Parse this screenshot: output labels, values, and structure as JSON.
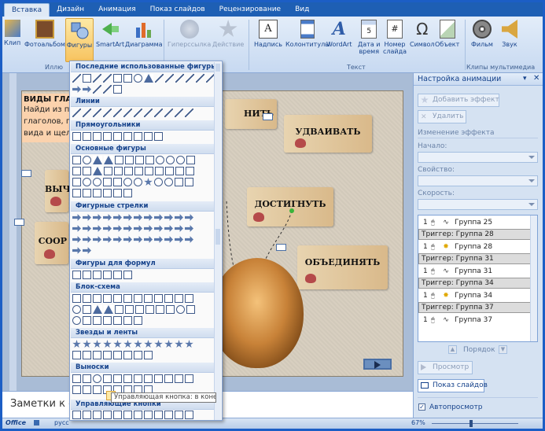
{
  "tabs": [
    "Вставка",
    "Дизайн",
    "Анимация",
    "Показ слайдов",
    "Рецензирование",
    "Вид"
  ],
  "ribbon": {
    "clip": "Клип",
    "photoalbum": "Фотоальбом",
    "shapes": "Фигуры",
    "smartart": "SmartArt",
    "chart": "Диаграмма",
    "hyperlink": "Гиперссылка",
    "action": "Действие",
    "textbox": "Надпись",
    "headers": "Колонтитулы",
    "wordart": "WordArt",
    "datetime_1": "Дата и",
    "datetime_2": "время",
    "slidenum_1": "Номер",
    "slidenum_2": "слайда",
    "symbol": "Символ",
    "object": "Объект",
    "movie": "Фильм",
    "sound": "Звук",
    "group_illustrations": "Иллю",
    "group_text": "Текст",
    "group_media": "Клипы мультимедиа"
  },
  "gallery": {
    "recent": "Последние использованные фигуры",
    "lines": "Линии",
    "rectangles": "Прямоугольники",
    "basic": "Основные фигуры",
    "arrows": "Фигурные стрелки",
    "equation": "Фигуры для формул",
    "flowchart": "Блок-схема",
    "stars": "Звезды и ленты",
    "callouts": "Выноски",
    "action_buttons": "Управляющие кнопки"
  },
  "tooltip": "Управляющая кнопка: в конец",
  "slide": {
    "heading": "ВИДЫ ГЛАГ",
    "text_1": "Найди из п",
    "text_2": "глаголов, г",
    "text_3": "вида и щел",
    "s_udvaivat": "УДВАИВАТЬ",
    "s_dostignut": "ДОСТИГНУТЬ",
    "s_obedinyat": "ОБЪЕДИНЯТЬ",
    "s_nit": "НИТЬ",
    "s_vych": "ВЫЧ",
    "s_soor": "СООР"
  },
  "notes": "Заметки к сл",
  "status": {
    "office": "Office",
    "lang": "русс",
    "zoom": "67%"
  },
  "pane": {
    "title": "Настройка анимации",
    "add_effect": "Добавить эффект",
    "remove": "Удалить",
    "change_effect": "Изменение эффекта",
    "start": "Начало:",
    "property": "Свойство:",
    "speed": "Скорость:",
    "items": [
      {
        "type": "row",
        "num": "1",
        "effect": "path",
        "label": "Группа 25"
      },
      {
        "type": "trigger",
        "label": "Триггер: Группа 28"
      },
      {
        "type": "row",
        "num": "1",
        "effect": "star",
        "label": "Группа 28"
      },
      {
        "type": "trigger",
        "label": "Триггер: Группа 31"
      },
      {
        "type": "row",
        "num": "1",
        "effect": "path",
        "label": "Группа 31"
      },
      {
        "type": "trigger",
        "label": "Триггер: Группа 34"
      },
      {
        "type": "row",
        "num": "1",
        "effect": "star",
        "label": "Группа 34"
      },
      {
        "type": "trigger",
        "label": "Триггер: Группа 37"
      },
      {
        "type": "row",
        "num": "1",
        "effect": "path",
        "label": "Группа 37"
      }
    ],
    "order": "Порядок",
    "preview": "Просмотр",
    "slideshow": "Показ слайдов",
    "autopreview": "Автопросмотр"
  }
}
